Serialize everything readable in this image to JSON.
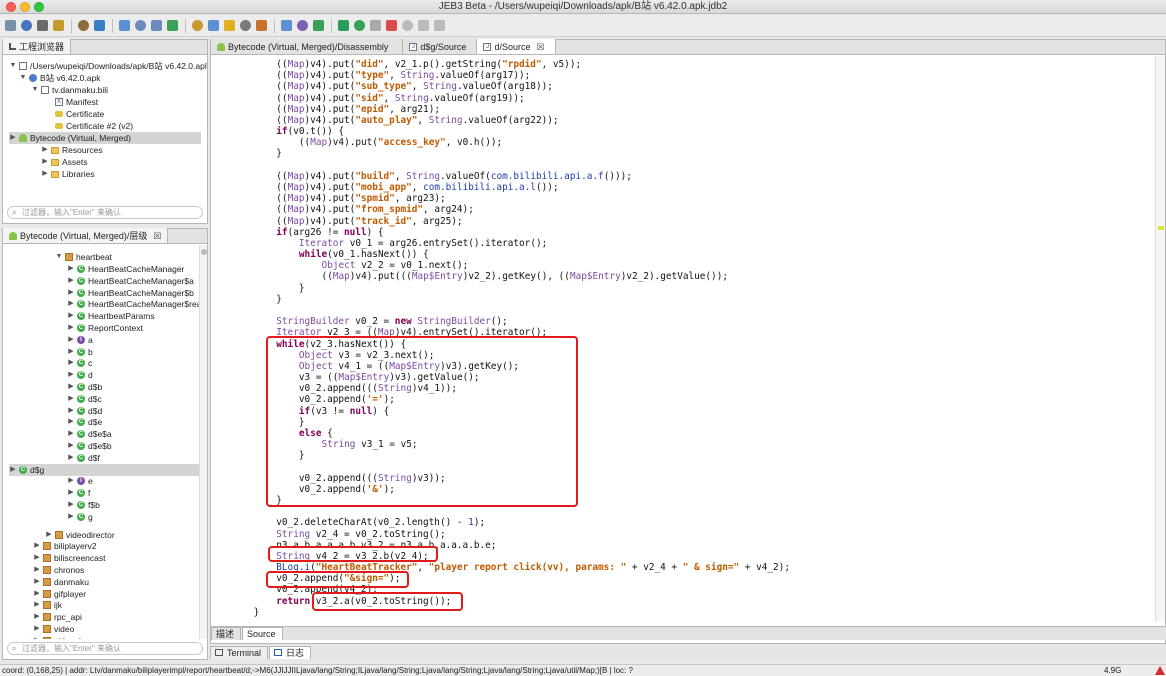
{
  "window": {
    "title": "JEB3 Beta - /Users/wupeiqi/Downloads/apk/B站 v6.42.0.apk.jdb2"
  },
  "left_top_panel": {
    "tab_label": "工程浏览器",
    "filter_placeholder": "过滤器，输入\"Enter\" 来确认",
    "tree": [
      {
        "label": "/Users/wupeiqi/Downloads/apk/B站 v6.42.0.apl",
        "icon": "project-icon"
      },
      {
        "label": "B站 v6.42.0.apk",
        "icon": "apk-icon"
      },
      {
        "label": "tv.danmaku.bili",
        "icon": "package-file-icon"
      },
      {
        "label": "Manifest",
        "icon": "manifest-icon"
      },
      {
        "label": "Certificate",
        "icon": "certificate-icon"
      },
      {
        "label": "Certificate #2 (v2)",
        "icon": "certificate-icon"
      },
      {
        "label": "Bytecode (Virtual, Merged)",
        "icon": "android-icon"
      },
      {
        "label": "Resources",
        "icon": "folder-icon"
      },
      {
        "label": "Assets",
        "icon": "folder-icon"
      },
      {
        "label": "Libraries",
        "icon": "folder-icon"
      }
    ]
  },
  "left_bottom_panel": {
    "tab_label": "Bytecode (Virtual, Merged)/层级",
    "tab_close": "☒",
    "filter_placeholder": "过滤器，输入\"Enter\" 来确认",
    "tree": [
      {
        "label": "heartbeat",
        "icon": "package-icon"
      },
      {
        "label": "HeartBeatCacheManager",
        "icon": "class-icon"
      },
      {
        "label": "HeartBeatCacheManager$a",
        "icon": "class-icon"
      },
      {
        "label": "HeartBeatCacheManager$b",
        "icon": "class-icon"
      },
      {
        "label": "HeartBeatCacheManager$read",
        "icon": "class-icon"
      },
      {
        "label": "HeartbeatParams",
        "icon": "class-icon"
      },
      {
        "label": "ReportContext",
        "icon": "class-icon"
      },
      {
        "label": "a",
        "icon": "interface-icon"
      },
      {
        "label": "b",
        "icon": "class-icon"
      },
      {
        "label": "c",
        "icon": "class-icon"
      },
      {
        "label": "d",
        "icon": "class-icon"
      },
      {
        "label": "d$b",
        "icon": "class-icon"
      },
      {
        "label": "d$c",
        "icon": "class-icon"
      },
      {
        "label": "d$d",
        "icon": "class-icon"
      },
      {
        "label": "d$e",
        "icon": "class-icon"
      },
      {
        "label": "d$e$a",
        "icon": "class-icon"
      },
      {
        "label": "d$e$b",
        "icon": "class-icon"
      },
      {
        "label": "d$f",
        "icon": "class-icon"
      },
      {
        "label": "d$g",
        "icon": "class-icon"
      },
      {
        "label": "e",
        "icon": "interface-icon"
      },
      {
        "label": "f",
        "icon": "class-icon"
      },
      {
        "label": "f$b",
        "icon": "class-icon"
      },
      {
        "label": "g",
        "icon": "class-icon"
      },
      {
        "label": "videodirector",
        "icon": "package-icon"
      },
      {
        "label": "biliplayerv2",
        "icon": "package-icon"
      },
      {
        "label": "biliscreencast",
        "icon": "package-icon"
      },
      {
        "label": "chronos",
        "icon": "package-icon"
      },
      {
        "label": "danmaku",
        "icon": "package-icon"
      },
      {
        "label": "gifplayer",
        "icon": "package-icon"
      },
      {
        "label": "ijk",
        "icon": "package-icon"
      },
      {
        "label": "rpc_api",
        "icon": "package-icon"
      },
      {
        "label": "video",
        "icon": "package-icon"
      },
      {
        "label": "videoplayer",
        "icon": "package-icon"
      }
    ]
  },
  "editor": {
    "tabs": [
      {
        "label": "Bytecode (Virtual, Merged)/Disassembly",
        "icon": "android-icon"
      },
      {
        "label": "d$g/Source",
        "icon": "source-file-icon"
      },
      {
        "label": "d/Source",
        "icon": "source-file-icon",
        "close": "☒"
      }
    ],
    "bottom_tabs": [
      "描述",
      "Source"
    ],
    "code_lines": [
      {
        "indent": 8,
        "tokens": [
          [
            "p",
            "(("
          ],
          [
            "t",
            "Map"
          ],
          [
            "p",
            ")v4).put("
          ],
          [
            "s",
            "\"did\""
          ],
          [
            "p",
            ", v2_1.p().getString("
          ],
          [
            "s",
            "\"rpdid\""
          ],
          [
            "p",
            ", v5));"
          ]
        ]
      },
      {
        "indent": 8,
        "tokens": [
          [
            "p",
            "(("
          ],
          [
            "t",
            "Map"
          ],
          [
            "p",
            ")v4).put("
          ],
          [
            "s",
            "\"type\""
          ],
          [
            "p",
            ", "
          ],
          [
            "t",
            "String"
          ],
          [
            "p",
            ".valueOf(arg17));"
          ]
        ]
      },
      {
        "indent": 8,
        "tokens": [
          [
            "p",
            "(("
          ],
          [
            "t",
            "Map"
          ],
          [
            "p",
            ")v4).put("
          ],
          [
            "s",
            "\"sub_type\""
          ],
          [
            "p",
            ", "
          ],
          [
            "t",
            "String"
          ],
          [
            "p",
            ".valueOf(arg18));"
          ]
        ]
      },
      {
        "indent": 8,
        "tokens": [
          [
            "p",
            "(("
          ],
          [
            "t",
            "Map"
          ],
          [
            "p",
            ")v4).put("
          ],
          [
            "s",
            "\"sid\""
          ],
          [
            "p",
            ", "
          ],
          [
            "t",
            "String"
          ],
          [
            "p",
            ".valueOf(arg19));"
          ]
        ]
      },
      {
        "indent": 8,
        "tokens": [
          [
            "p",
            "(("
          ],
          [
            "t",
            "Map"
          ],
          [
            "p",
            ")v4).put("
          ],
          [
            "s",
            "\"epid\""
          ],
          [
            "p",
            ", arg21);"
          ]
        ]
      },
      {
        "indent": 8,
        "tokens": [
          [
            "p",
            "(("
          ],
          [
            "t",
            "Map"
          ],
          [
            "p",
            ")v4).put("
          ],
          [
            "s",
            "\"auto_play\""
          ],
          [
            "p",
            ", "
          ],
          [
            "t",
            "String"
          ],
          [
            "p",
            ".valueOf(arg22));"
          ]
        ]
      },
      {
        "indent": 8,
        "tokens": [
          [
            "k",
            "if"
          ],
          [
            "p",
            "(v0.t()) {"
          ]
        ]
      },
      {
        "indent": 12,
        "tokens": [
          [
            "p",
            "(("
          ],
          [
            "t",
            "Map"
          ],
          [
            "p",
            ")v4).put("
          ],
          [
            "s",
            "\"access_key\""
          ],
          [
            "p",
            ", v0.h());"
          ]
        ]
      },
      {
        "indent": 8,
        "tokens": [
          [
            "p",
            "}"
          ]
        ]
      },
      {
        "indent": 0,
        "tokens": []
      },
      {
        "indent": 8,
        "tokens": [
          [
            "p",
            "(("
          ],
          [
            "t",
            "Map"
          ],
          [
            "p",
            ")v4).put("
          ],
          [
            "s",
            "\"build\""
          ],
          [
            "p",
            ", "
          ],
          [
            "t",
            "String"
          ],
          [
            "p",
            ".valueOf("
          ],
          [
            "n",
            "com.bilibili.api.a.f"
          ],
          [
            "p",
            "()));"
          ]
        ]
      },
      {
        "indent": 8,
        "tokens": [
          [
            "p",
            "(("
          ],
          [
            "t",
            "Map"
          ],
          [
            "p",
            ")v4).put("
          ],
          [
            "s",
            "\"mobi_app\""
          ],
          [
            "p",
            ", "
          ],
          [
            "n",
            "com.bilibili.api.a.l"
          ],
          [
            "p",
            "());"
          ]
        ]
      },
      {
        "indent": 8,
        "tokens": [
          [
            "p",
            "(("
          ],
          [
            "t",
            "Map"
          ],
          [
            "p",
            ")v4).put("
          ],
          [
            "s",
            "\"spmid\""
          ],
          [
            "p",
            ", arg23);"
          ]
        ]
      },
      {
        "indent": 8,
        "tokens": [
          [
            "p",
            "(("
          ],
          [
            "t",
            "Map"
          ],
          [
            "p",
            ")v4).put("
          ],
          [
            "s",
            "\"from_spmid\""
          ],
          [
            "p",
            ", arg24);"
          ]
        ]
      },
      {
        "indent": 8,
        "tokens": [
          [
            "p",
            "(("
          ],
          [
            "t",
            "Map"
          ],
          [
            "p",
            ")v4).put("
          ],
          [
            "s",
            "\"track_id\""
          ],
          [
            "p",
            ", arg25);"
          ]
        ]
      },
      {
        "indent": 8,
        "tokens": [
          [
            "k",
            "if"
          ],
          [
            "p",
            "(arg26 != "
          ],
          [
            "k",
            "null"
          ],
          [
            "p",
            ") {"
          ]
        ]
      },
      {
        "indent": 12,
        "tokens": [
          [
            "t",
            "Iterator"
          ],
          [
            "p",
            " v0_1 = arg26.entrySet().iterator();"
          ]
        ]
      },
      {
        "indent": 12,
        "tokens": [
          [
            "k",
            "while"
          ],
          [
            "p",
            "(v0_1.hasNext()) {"
          ]
        ]
      },
      {
        "indent": 16,
        "tokens": [
          [
            "t",
            "Object"
          ],
          [
            "p",
            " v2_2 = v0_1.next();"
          ]
        ]
      },
      {
        "indent": 16,
        "tokens": [
          [
            "p",
            "(("
          ],
          [
            "t",
            "Map"
          ],
          [
            "p",
            ")v4).put((("
          ],
          [
            "t",
            "Map$Entry"
          ],
          [
            "p",
            ")v2_2).getKey(), (("
          ],
          [
            "t",
            "Map$Entry"
          ],
          [
            "p",
            ")v2_2).getValue());"
          ]
        ]
      },
      {
        "indent": 12,
        "tokens": [
          [
            "p",
            "}"
          ]
        ]
      },
      {
        "indent": 8,
        "tokens": [
          [
            "p",
            "}"
          ]
        ]
      },
      {
        "indent": 0,
        "tokens": []
      },
      {
        "indent": 8,
        "tokens": [
          [
            "t",
            "StringBuilder"
          ],
          [
            "p",
            " v0_2 = "
          ],
          [
            "k",
            "new"
          ],
          [
            "p",
            " "
          ],
          [
            "t",
            "StringBuilder"
          ],
          [
            "p",
            "();"
          ]
        ]
      },
      {
        "indent": 8,
        "tokens": [
          [
            "t",
            "Iterator"
          ],
          [
            "p",
            " v2_3 = (("
          ],
          [
            "t",
            "Map"
          ],
          [
            "p",
            ")v4).entrySet().iterator();"
          ]
        ]
      },
      {
        "indent": 8,
        "tokens": [
          [
            "k",
            "while"
          ],
          [
            "p",
            "(v2_3.hasNext()) {"
          ]
        ]
      },
      {
        "indent": 12,
        "tokens": [
          [
            "t",
            "Object"
          ],
          [
            "p",
            " v3 = v2_3.next();"
          ]
        ]
      },
      {
        "indent": 12,
        "tokens": [
          [
            "t",
            "Object"
          ],
          [
            "p",
            " v4_1 = (("
          ],
          [
            "t",
            "Map$Entry"
          ],
          [
            "p",
            ")v3).getKey();"
          ]
        ]
      },
      {
        "indent": 12,
        "tokens": [
          [
            "p",
            "v3 = (("
          ],
          [
            "t",
            "Map$Entry"
          ],
          [
            "p",
            ")v3).getValue();"
          ]
        ]
      },
      {
        "indent": 12,
        "tokens": [
          [
            "p",
            "v0_2.append((("
          ],
          [
            "t",
            "String"
          ],
          [
            "p",
            ")v4_1));"
          ]
        ]
      },
      {
        "indent": 12,
        "tokens": [
          [
            "p",
            "v0_2.append("
          ],
          [
            "s",
            "'='"
          ],
          [
            "p",
            ");"
          ]
        ]
      },
      {
        "indent": 12,
        "tokens": [
          [
            "k",
            "if"
          ],
          [
            "p",
            "(v3 != "
          ],
          [
            "k",
            "null"
          ],
          [
            "p",
            ") {"
          ]
        ]
      },
      {
        "indent": 12,
        "tokens": [
          [
            "p",
            "}"
          ]
        ]
      },
      {
        "indent": 12,
        "tokens": [
          [
            "k",
            "else"
          ],
          [
            "p",
            " {"
          ]
        ]
      },
      {
        "indent": 16,
        "tokens": [
          [
            "t",
            "String"
          ],
          [
            "p",
            " v3_1 = v5;"
          ]
        ]
      },
      {
        "indent": 12,
        "tokens": [
          [
            "p",
            "}"
          ]
        ]
      },
      {
        "indent": 0,
        "tokens": []
      },
      {
        "indent": 12,
        "tokens": [
          [
            "p",
            "v0_2.append((("
          ],
          [
            "t",
            "String"
          ],
          [
            "p",
            ")v3));"
          ]
        ]
      },
      {
        "indent": 12,
        "tokens": [
          [
            "p",
            "v0_2.append("
          ],
          [
            "s",
            "'&'"
          ],
          [
            "p",
            ");"
          ]
        ]
      },
      {
        "indent": 8,
        "tokens": [
          [
            "p",
            "}"
          ]
        ]
      },
      {
        "indent": 0,
        "tokens": []
      },
      {
        "indent": 8,
        "tokens": [
          [
            "p",
            "v0_2.deleteCharAt(v0_2.length() - "
          ],
          [
            "n",
            "1"
          ],
          [
            "p",
            ");"
          ]
        ]
      },
      {
        "indent": 8,
        "tokens": [
          [
            "t",
            "String"
          ],
          [
            "p",
            " v2_4 = v0_2.toString();"
          ]
        ]
      },
      {
        "indent": 8,
        "tokens": [
          [
            "p",
            "n3.a.b.a.a.a.b v3_2 = n3.a.b.a.a.a.b.e;"
          ]
        ]
      },
      {
        "indent": 8,
        "tokens": [
          [
            "t",
            "String"
          ],
          [
            "p",
            " v4_2 = v3_2.b(v2_4);"
          ]
        ]
      },
      {
        "indent": 8,
        "tokens": [
          [
            "n",
            "BLog.i"
          ],
          [
            "p",
            "("
          ],
          [
            "s",
            "\"HeartBeatTracker\""
          ],
          [
            "p",
            ", "
          ],
          [
            "s",
            "\"player report click(vv), params: \""
          ],
          [
            "p",
            " + v2_4 + "
          ],
          [
            "s",
            "\" & sign=\""
          ],
          [
            "p",
            " + v4_2);"
          ]
        ]
      },
      {
        "indent": 8,
        "tokens": [
          [
            "p",
            "v0_2.append("
          ],
          [
            "s",
            "\"&sign=\""
          ],
          [
            "p",
            ");"
          ]
        ]
      },
      {
        "indent": 8,
        "tokens": [
          [
            "p",
            "v0_2.append(v4_2);"
          ]
        ]
      },
      {
        "indent": 8,
        "tokens": [
          [
            "k",
            "return"
          ],
          [
            "p",
            " v3_2.a(v0_2.toString());"
          ]
        ]
      },
      {
        "indent": 4,
        "tokens": [
          [
            "p",
            "}"
          ]
        ]
      }
    ]
  },
  "console_tabs": {
    "terminal": "Terminal",
    "log": "日志"
  },
  "statusbar": {
    "text": "coord: (0,168,25) | addr: Ltv/danmaku/biliplayerimpl/report/heartbeat/d;->M6(JJIJJIILjava/lang/String;ILjava/lang/String;Ljava/lang/String;Ljava/lang/String;Ljava/util/Map;)[B | loc: ?",
    "memory": "4.9G"
  },
  "colors": {
    "keyword": "#7f0055",
    "type": "#7d4a9f",
    "string": "#c05a00",
    "highlight_box": "#e11b1b",
    "selection": "#d4d4d4"
  },
  "toolbar": {
    "icons": [
      "open-icon",
      "save-icon",
      "settings-icon",
      "export-icon",
      "lock-icon",
      "globe-icon",
      "jump-icon",
      "back-icon",
      "forward-icon",
      "refresh-icon",
      "decompile-icon",
      "rename-icon",
      "comment-icon",
      "doc-icon",
      "grid-icon",
      "xref-icon",
      "graph-icon",
      "code-icon",
      "debug-icon",
      "run-icon",
      "pause-icon",
      "stop-icon",
      "step-into-icon",
      "step-over-icon",
      "step-out-icon"
    ]
  }
}
